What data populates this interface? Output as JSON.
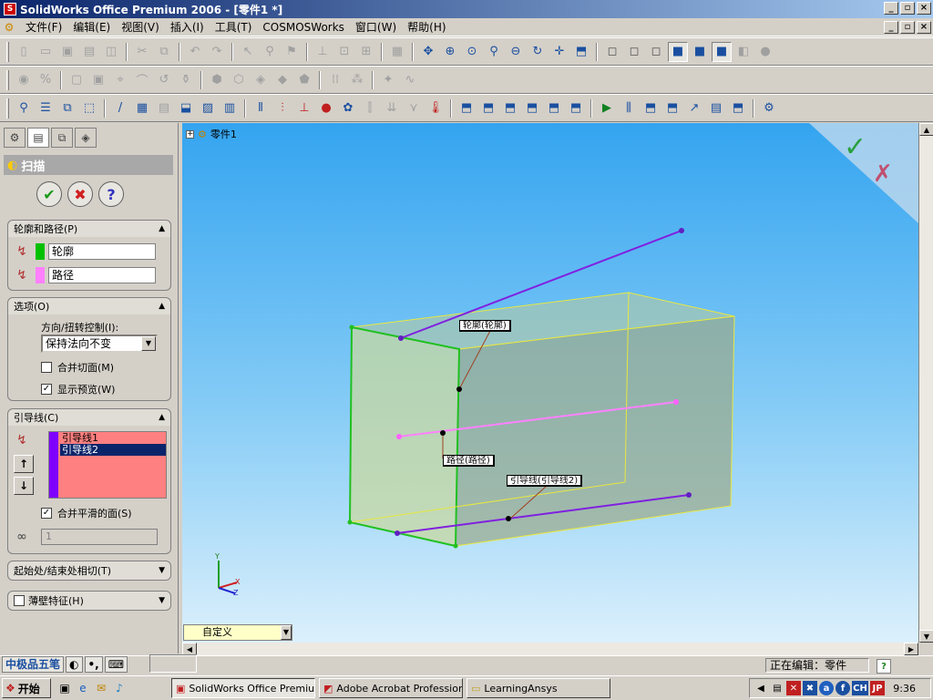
{
  "window": {
    "title": "SolidWorks Office Premium 2006 - [零件1 *]"
  },
  "menu": {
    "items": [
      "文件(F)",
      "编辑(E)",
      "视图(V)",
      "插入(I)",
      "工具(T)",
      "COSMOSWorks",
      "窗口(W)",
      "帮助(H)"
    ]
  },
  "feature_tree": {
    "root_label": "零件1"
  },
  "property_manager": {
    "title": "扫描",
    "profile_path": {
      "header": "轮廓和路径(P)",
      "profile_value": "轮廓",
      "path_value": "路径",
      "profile_color": "#00c000",
      "path_color": "#ff80ff"
    },
    "options": {
      "header": "选项(O)",
      "direction_label": "方向/扭转控制(I):",
      "direction_value": "保持法向不变",
      "merge_tangent_label": "合并切面(M)",
      "merge_tangent_checked": false,
      "show_preview_label": "显示预览(W)",
      "show_preview_checked": true
    },
    "guides": {
      "header": "引导线(C)",
      "items": [
        "引导线1",
        "引导线2"
      ],
      "selected_index": 1,
      "merge_smooth_label": "合并平滑的面(S)",
      "merge_smooth_checked": true,
      "spin_value": "1",
      "list_color": "#ff8080",
      "bar_color": "#8000ff"
    },
    "start_end": {
      "header": "起始处/结束处相切(T)"
    },
    "thin": {
      "header": "薄壁特征(H)",
      "checked": false
    }
  },
  "viewport": {
    "callouts": {
      "profile": "轮廓(轮廓)",
      "path": "路径(路径)",
      "guide": "引导线(引导线2)"
    },
    "axes": {
      "y": "Y",
      "x": "X",
      "z": "Z"
    },
    "view_combo_value": "自定义"
  },
  "status": {
    "ime_label": "中极品五笔",
    "editing": "正在编辑：零件"
  },
  "taskbar": {
    "start_label": "开始",
    "tasks": [
      {
        "label": "SolidWorks Office Premiu...",
        "active": true
      },
      {
        "label": "Adobe Acrobat Professional",
        "active": false
      },
      {
        "label": "LearningAnsys",
        "active": false
      }
    ],
    "tray_lang": "CH",
    "tray_jp": "JP",
    "clock": "9:36"
  }
}
